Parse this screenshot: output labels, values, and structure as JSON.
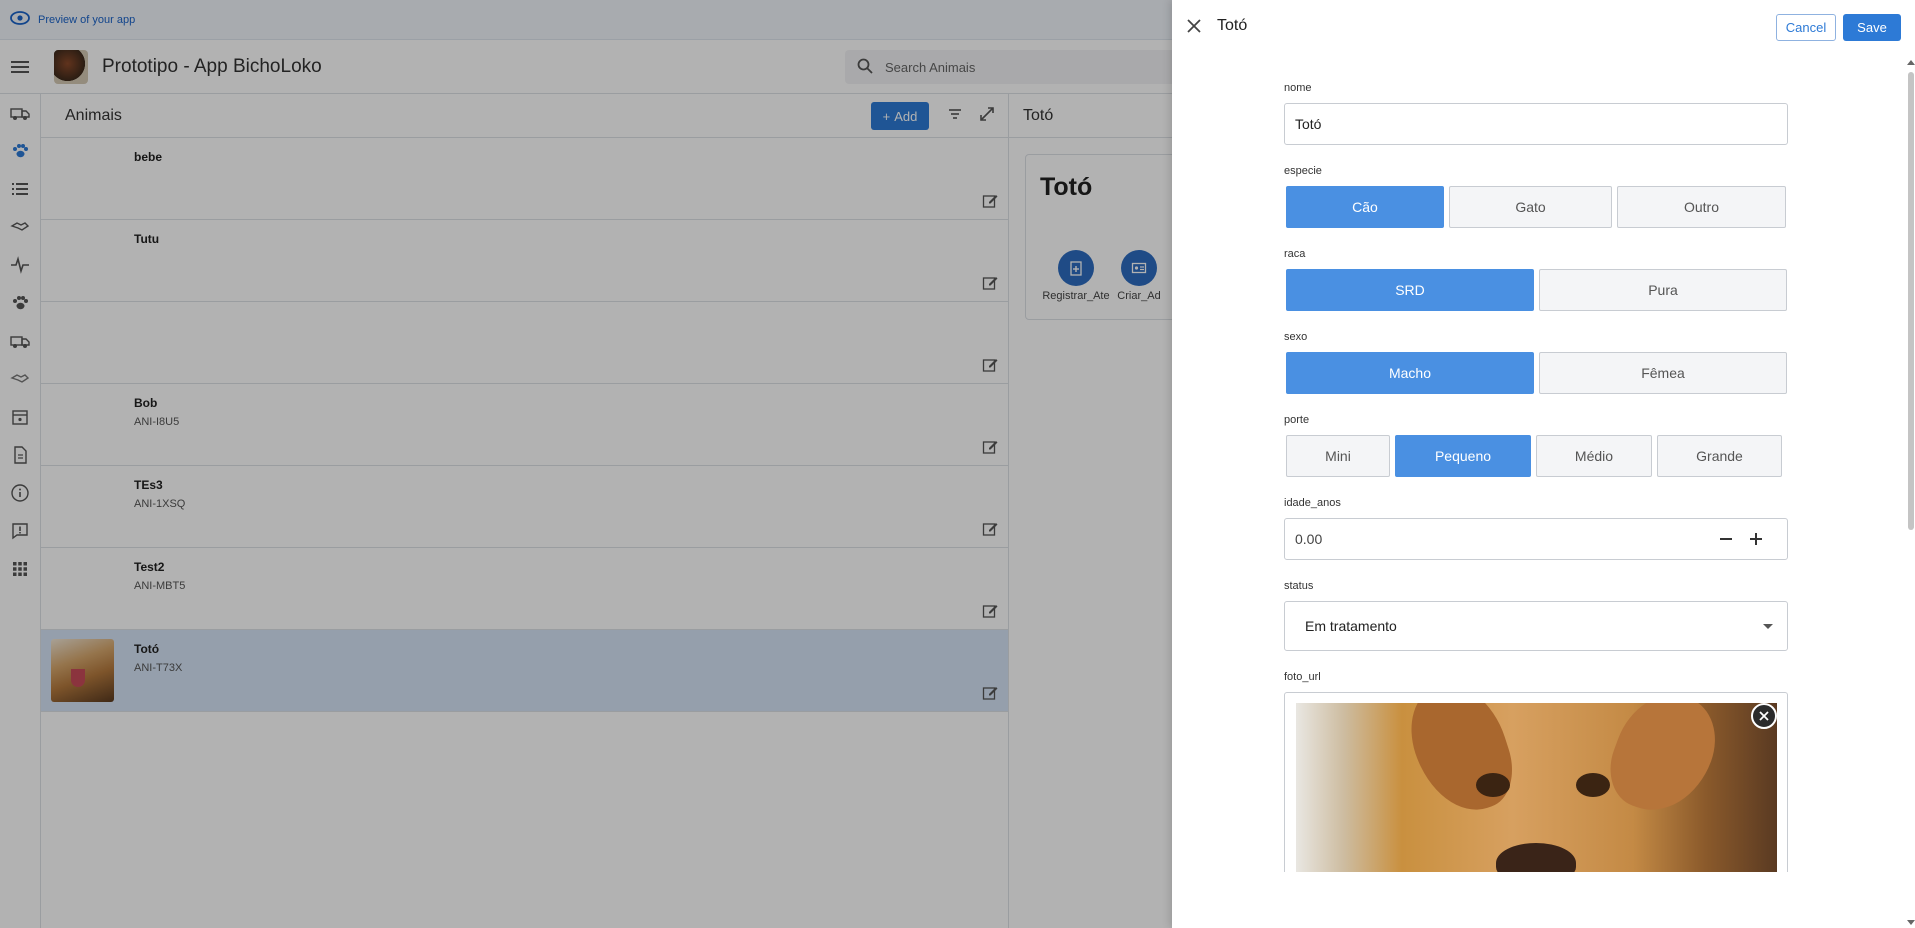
{
  "preview_bar": {
    "label": "Preview of your app"
  },
  "header": {
    "title": "Prototipo - App BichoLoko",
    "search_placeholder": "Search Animais"
  },
  "rail_icons": [
    "ambulance-icon",
    "paw-icon",
    "list-icon",
    "handshake-icon",
    "pulse-icon",
    "paw-icon",
    "ambulance-icon",
    "handshake-icon",
    "calendar-icon",
    "document-icon",
    "info-icon",
    "feedback-icon",
    "apps-grid-icon"
  ],
  "list": {
    "title": "Animais",
    "add_label": "Add",
    "rows": [
      {
        "name": "bebe",
        "code": ""
      },
      {
        "name": "Tutu",
        "code": ""
      },
      {
        "name": "",
        "code": ""
      },
      {
        "name": "Bob",
        "code": "ANI-I8U5"
      },
      {
        "name": "TEs3",
        "code": "ANI-1XSQ"
      },
      {
        "name": "Test2",
        "code": "ANI-MBT5"
      },
      {
        "name": "Totó",
        "code": "ANI-T73X"
      }
    ]
  },
  "detail": {
    "header": "Totó",
    "card_title": "Totó",
    "actions": [
      {
        "label": "Registrar_Ate"
      },
      {
        "label": "Criar_Ad"
      }
    ]
  },
  "drawer": {
    "title": "Totó",
    "cancel_label": "Cancel",
    "save_label": "Save",
    "fields": {
      "nome": {
        "label": "nome",
        "value": "Totó"
      },
      "especie": {
        "label": "especie",
        "options": [
          "Cão",
          "Gato",
          "Outro"
        ],
        "selected": "Cão"
      },
      "raca": {
        "label": "raca",
        "options": [
          "SRD",
          "Pura"
        ],
        "selected": "SRD"
      },
      "sexo": {
        "label": "sexo",
        "options": [
          "Macho",
          "Fêmea"
        ],
        "selected": "Macho"
      },
      "porte": {
        "label": "porte",
        "options": [
          "Mini",
          "Pequeno",
          "Médio",
          "Grande"
        ],
        "selected": "Pequeno"
      },
      "idade_anos": {
        "label": "idade_anos",
        "value": "0.00"
      },
      "status": {
        "label": "status",
        "value": "Em tratamento"
      },
      "foto_url": {
        "label": "foto_url"
      }
    }
  },
  "colors": {
    "accent": "#2d7ad6",
    "segment_active": "#4a90e2",
    "selected_row": "#d6e4f7",
    "overlay": "rgba(0,0,0,0.30)"
  }
}
